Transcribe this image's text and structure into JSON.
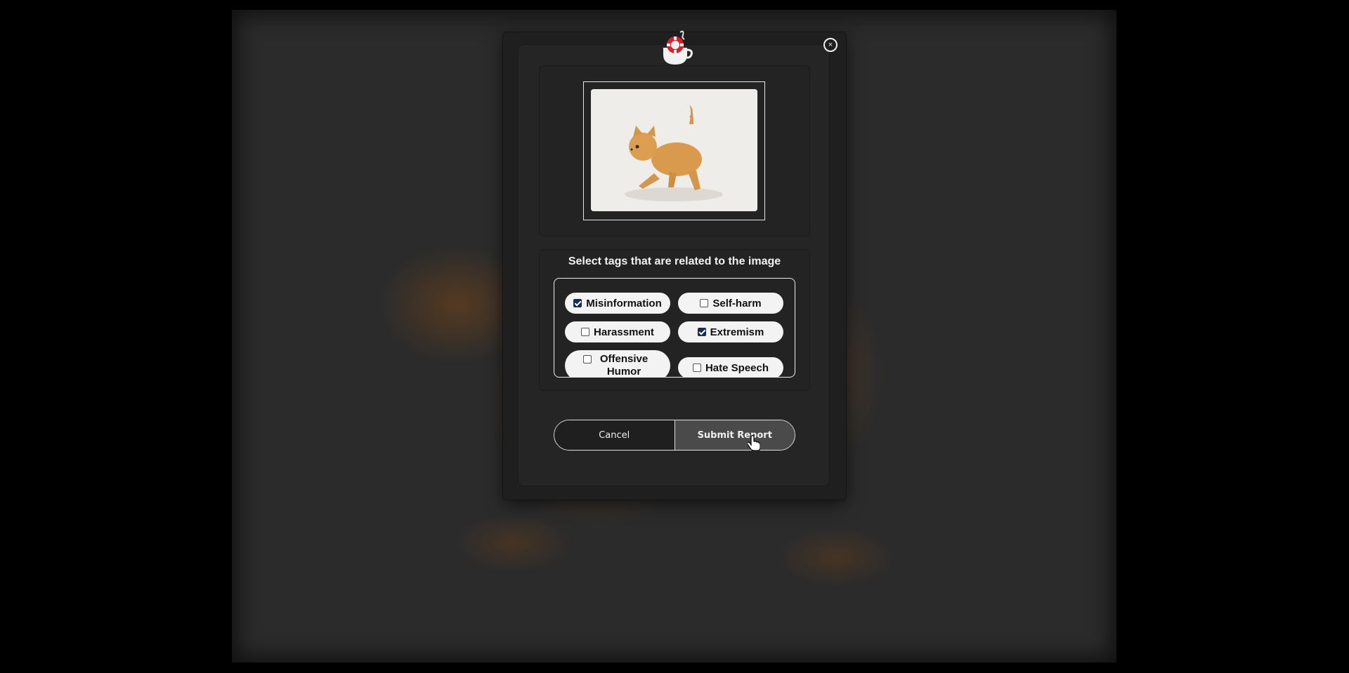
{
  "modal": {
    "close_label": "×",
    "logo_icon": "teacup-lifebuoy-logo-icon"
  },
  "tags": {
    "title": "Select tags that are related to the image",
    "items": [
      {
        "label": "Misinformation",
        "checked": true
      },
      {
        "label": "Self-harm",
        "checked": false
      },
      {
        "label": "Harassment",
        "checked": false
      },
      {
        "label": "Extremism",
        "checked": true
      },
      {
        "label": "Offensive Humor",
        "checked": false
      },
      {
        "label": "Hate Speech",
        "checked": false
      }
    ]
  },
  "actions": {
    "cancel_label": "Cancel",
    "submit_label": "Submit Report"
  },
  "colors": {
    "checked": "#1a2b57",
    "modal_bg": "#1f1f1f",
    "submit_bg": "#4a4a4a"
  }
}
